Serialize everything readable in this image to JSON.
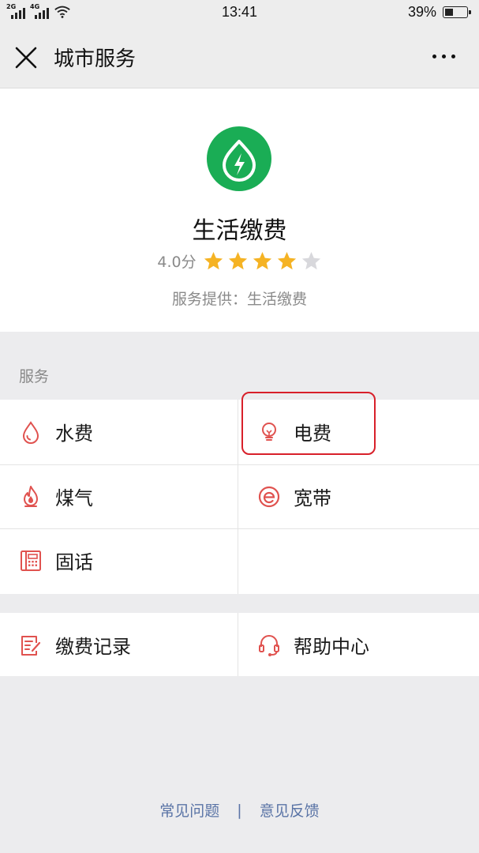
{
  "status_bar": {
    "signal_1_label": "2G",
    "signal_2_label": "4G",
    "time": "13:41",
    "battery_percent": "39%",
    "battery_level": 0.39
  },
  "nav": {
    "title": "城市服务"
  },
  "service_profile": {
    "name": "生活缴费",
    "score": "4.0分",
    "stars_filled": 4,
    "stars_total": 5,
    "provider": "服务提供：生活缴费"
  },
  "section": {
    "title": "服务"
  },
  "services": [
    {
      "label": "水费",
      "icon": "water-drop-icon"
    },
    {
      "label": "电费",
      "icon": "light-bulb-icon"
    },
    {
      "label": "煤气",
      "icon": "gas-flame-icon"
    },
    {
      "label": "宽带",
      "icon": "broadband-e-icon"
    },
    {
      "label": "固话",
      "icon": "landline-phone-icon"
    }
  ],
  "extras": [
    {
      "label": "缴费记录",
      "icon": "payment-record-icon"
    },
    {
      "label": "帮助中心",
      "icon": "headset-icon"
    }
  ],
  "footer": {
    "faq": "常见问题",
    "separator": "|",
    "feedback": "意见反馈"
  },
  "colors": {
    "accent_green": "#1aad55",
    "icon_red": "#e0524f",
    "star_gold": "#f5b324",
    "star_empty": "#d8d8dc",
    "highlight_red": "#d8202a",
    "link_blue": "#5a74a6"
  }
}
